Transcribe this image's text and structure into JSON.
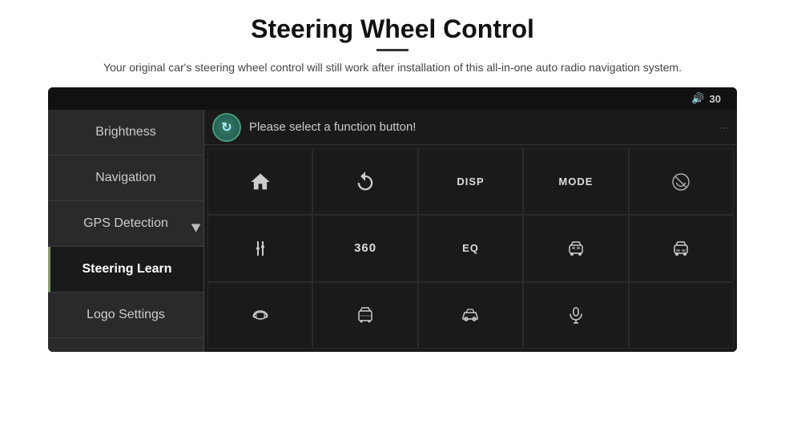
{
  "header": {
    "title": "Steering Wheel Control",
    "divider": true,
    "subtitle": "Your original car's steering wheel control will still work after installation of this all-in-one auto radio navigation system."
  },
  "screen": {
    "topbar": {
      "volume_label": "30",
      "volume_icon": "🔊"
    },
    "sidebar": {
      "items": [
        {
          "label": "Brightness",
          "active": false
        },
        {
          "label": "Navigation",
          "active": false
        },
        {
          "label": "GPS Detection",
          "active": false
        },
        {
          "label": "Steering Learn",
          "active": true
        },
        {
          "label": "Logo Settings",
          "active": false
        }
      ]
    },
    "main": {
      "prompt": "Please select a function button!",
      "sync_icon": "↻",
      "grid": [
        [
          {
            "type": "home",
            "label": ""
          },
          {
            "type": "back",
            "label": ""
          },
          {
            "type": "text",
            "label": "DISP"
          },
          {
            "type": "text",
            "label": "MODE"
          },
          {
            "type": "phone-off",
            "label": ""
          }
        ],
        [
          {
            "type": "tune",
            "label": ""
          },
          {
            "type": "text",
            "label": "360"
          },
          {
            "type": "text",
            "label": "EQ"
          },
          {
            "type": "car-front",
            "label": ""
          },
          {
            "type": "car-rear",
            "label": ""
          }
        ],
        [
          {
            "type": "car-top",
            "label": ""
          },
          {
            "type": "car-door",
            "label": ""
          },
          {
            "type": "car-side",
            "label": ""
          },
          {
            "type": "mic",
            "label": ""
          },
          {
            "type": "empty",
            "label": ""
          }
        ]
      ]
    }
  }
}
